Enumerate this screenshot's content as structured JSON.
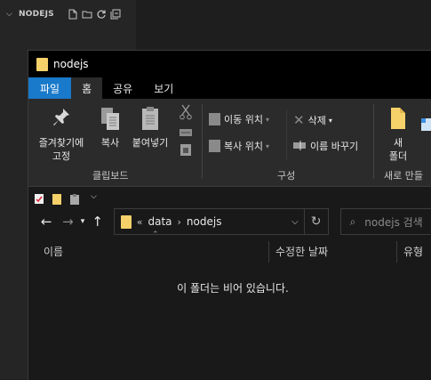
{
  "vscode": {
    "section_title": "NODEJS",
    "actions": [
      "new-file-icon",
      "new-folder-icon",
      "refresh-icon",
      "collapse-all-icon"
    ]
  },
  "explorer": {
    "window_title": "nodejs",
    "tabs": [
      {
        "label": "파일"
      },
      {
        "label": "홈"
      },
      {
        "label": "공유"
      },
      {
        "label": "보기"
      }
    ],
    "ribbon": {
      "clipboard": {
        "pin_label_1": "즐겨찾기에",
        "pin_label_2": "고정",
        "copy_label": "복사",
        "paste_label": "붙여넣기",
        "group_label": "클립보드"
      },
      "organize": {
        "move_to": "이동 위치",
        "copy_to": "복사 위치",
        "delete": "삭제",
        "rename": "이름 바꾸기",
        "group_label": "구성"
      },
      "new": {
        "new_folder_1": "새",
        "new_folder_2": "폴더",
        "group_label": "새로 만들"
      }
    },
    "address": {
      "overflow": "«",
      "crumbs": [
        "data",
        "nodejs"
      ],
      "search_placeholder": "nodejs 검색"
    },
    "columns": {
      "name": "이름",
      "modified": "수정한 날짜",
      "type": "유형"
    },
    "empty_message": "이 폴더는 비어 있습니다."
  },
  "colors": {
    "file_tab": "#1979ca",
    "folder": "#f6d16a",
    "ribbon_bg": "#2b2b2b",
    "titlebar_bg": "#000000"
  }
}
